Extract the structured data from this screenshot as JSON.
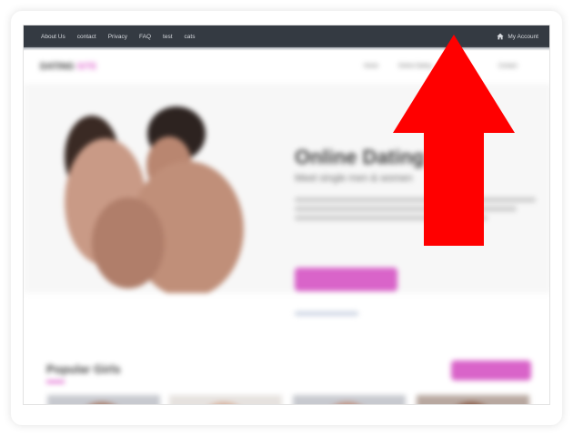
{
  "topbar": {
    "links": [
      "About Us",
      "contact",
      "Privacy",
      "FAQ",
      "test",
      "cats"
    ],
    "account_label": "My Account",
    "icon": "home-icon"
  },
  "site": {
    "logo_main": "DATING",
    "logo_accent": "SITE",
    "nav_items": [
      "Home",
      "Online Dating",
      "Contact"
    ],
    "hero_title": "Online Dating Site",
    "hero_subtitle": "Meet single men & women",
    "popular_title": "Popular Girls"
  },
  "overlay": {
    "arrow_color": "#ff0000",
    "direction": "up"
  }
}
